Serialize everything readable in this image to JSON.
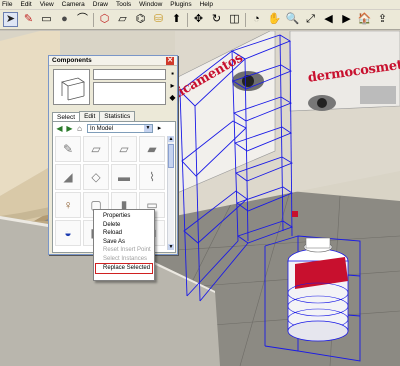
{
  "menu": [
    "File",
    "Edit",
    "View",
    "Camera",
    "Draw",
    "Tools",
    "Window",
    "Plugins",
    "Help"
  ],
  "toolbar_icons": [
    {
      "name": "select-arrow-icon",
      "glyph": "➤",
      "selected": true
    },
    {
      "name": "pencil-icon",
      "glyph": "✎"
    },
    {
      "name": "rectangle-icon",
      "glyph": "▭"
    },
    {
      "name": "circle-icon",
      "glyph": "●"
    },
    {
      "name": "arc-icon",
      "glyph": "⌒"
    },
    {
      "name": "make-component-icon",
      "glyph": "⬡"
    },
    {
      "name": "eraser-icon",
      "glyph": "▱"
    },
    {
      "name": "tape-measure-icon",
      "glyph": "⌬"
    },
    {
      "name": "paint-bucket-icon",
      "glyph": "⛁"
    },
    {
      "name": "push-pull-icon",
      "glyph": "⬆"
    },
    {
      "name": "move-icon",
      "glyph": "✥"
    },
    {
      "name": "rotate-icon",
      "glyph": "↻"
    },
    {
      "name": "offset-icon",
      "glyph": "◫"
    },
    {
      "name": "orbit-icon",
      "glyph": "◔"
    },
    {
      "name": "pan-icon",
      "glyph": "✋"
    },
    {
      "name": "zoom-icon",
      "glyph": "🔍"
    },
    {
      "name": "zoom-extents-icon",
      "glyph": "⤢"
    },
    {
      "name": "previous-view-icon",
      "glyph": "◀"
    },
    {
      "name": "next-view-icon",
      "glyph": "▶"
    },
    {
      "name": "get-models-icon",
      "glyph": "🏠"
    },
    {
      "name": "share-model-icon",
      "glyph": "⇪"
    }
  ],
  "components": {
    "title": "Components",
    "close_glyph": "✕",
    "tabs": [
      "Select",
      "Edit",
      "Statistics"
    ],
    "active_tab": "Select",
    "location": "In Model",
    "grid_items": [
      {
        "name": "component-pencil",
        "glyph": "✎"
      },
      {
        "name": "component-paper",
        "glyph": "▱"
      },
      {
        "name": "component-paper-2",
        "glyph": "▱"
      },
      {
        "name": "component-book",
        "glyph": "▰"
      },
      {
        "name": "component-fish",
        "glyph": "◢"
      },
      {
        "name": "component-box",
        "glyph": "◇"
      },
      {
        "name": "component-rack",
        "glyph": "▬"
      },
      {
        "name": "component-bottle",
        "glyph": "⌇"
      },
      {
        "name": "component-person",
        "glyph": "♀"
      },
      {
        "name": "component-bag",
        "glyph": "▢"
      },
      {
        "name": "component-panel",
        "glyph": "▮"
      },
      {
        "name": "component-sheet",
        "glyph": "▭"
      },
      {
        "name": "component-car",
        "glyph": "◒"
      },
      {
        "name": "component-shelf",
        "glyph": "◧"
      },
      {
        "name": "component-stand",
        "glyph": "▭"
      },
      {
        "name": "component-frame",
        "glyph": "□"
      }
    ]
  },
  "context_menu": {
    "items": [
      {
        "label": "Properties",
        "enabled": true
      },
      {
        "label": "Delete",
        "enabled": true
      },
      {
        "label": "Reload",
        "enabled": true
      },
      {
        "label": "Save As",
        "enabled": true
      },
      {
        "label": "Reset Insert Point",
        "enabled": false
      },
      {
        "label": "Select Instances",
        "enabled": false
      },
      {
        "label": "Replace Selected",
        "enabled": true,
        "highlighted": true
      }
    ]
  },
  "scene": {
    "sign_left_text": "dicamentos",
    "sign_right_text": "dermocosmeti",
    "accent_red": "#c8102e",
    "wire_blue": "#1a1ae6"
  }
}
